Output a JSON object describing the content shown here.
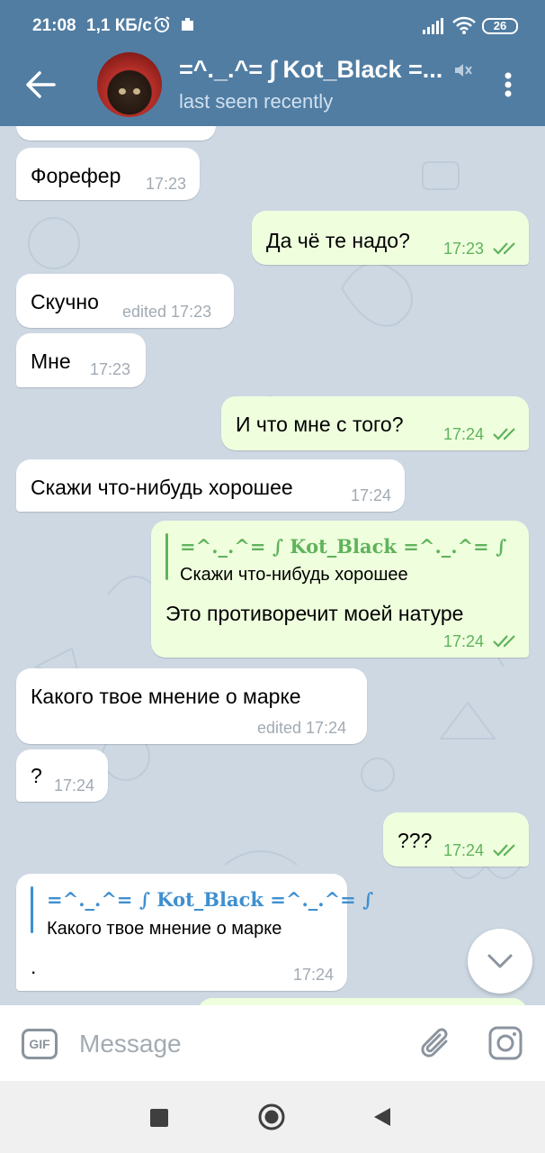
{
  "status_bar": {
    "time": "21:08",
    "speed": "1,1 КБ/с",
    "battery": "26"
  },
  "header": {
    "title": "=^._.^= ∫ Kot_Black =...",
    "status": "last seen recently"
  },
  "messages": [
    {
      "direction": "in",
      "text": "Форефер",
      "time": "17:23"
    },
    {
      "direction": "out",
      "text": "Да чё те надо?",
      "time": "17:23",
      "read": true
    },
    {
      "direction": "in",
      "text": "Скучно",
      "time": "edited 17:23"
    },
    {
      "direction": "in",
      "text": "Мне",
      "time": "17:23"
    },
    {
      "direction": "out",
      "text": "И что мне с того?",
      "time": "17:24",
      "read": true
    },
    {
      "direction": "in",
      "text": "Скажи что-нибудь хорошее",
      "time": "17:24"
    },
    {
      "direction": "out",
      "reply_name": "=^._.^= ∫ Kot_Black =^._.^= ∫",
      "reply_text": "Скажи что-нибудь хорошее",
      "text": "Это противоречит моей натуре",
      "time": "17:24",
      "read": true
    },
    {
      "direction": "in",
      "text": "Какого твое мнение о марке",
      "time": "edited 17:24"
    },
    {
      "direction": "in",
      "text": "?",
      "time": "17:24"
    },
    {
      "direction": "out",
      "text": "???",
      "time": "17:24",
      "read": true
    },
    {
      "direction": "in",
      "reply_name": "=^._.^= ∫ Kot_Black =^._.^= ∫",
      "reply_text": "Какого твое мнение о марке",
      "text": ".",
      "time": "17:24"
    }
  ],
  "input": {
    "placeholder": "Message",
    "gif_label": "GIF"
  },
  "colors": {
    "header": "#517da2",
    "incoming_bubble": "#ffffff",
    "outgoing_bubble": "#efffde",
    "outgoing_meta": "#5fb35b",
    "reply_in": "#3e8fd0",
    "reply_out": "#5fb35b",
    "chat_background": "#cdd8e3"
  },
  "icons": {
    "back": "arrow-left-icon",
    "mute": "muted-speaker-icon",
    "menu": "vertical-dots-icon",
    "scroll": "chevron-down-icon",
    "attach": "paperclip-icon",
    "camera": "instagram-camera-icon"
  }
}
